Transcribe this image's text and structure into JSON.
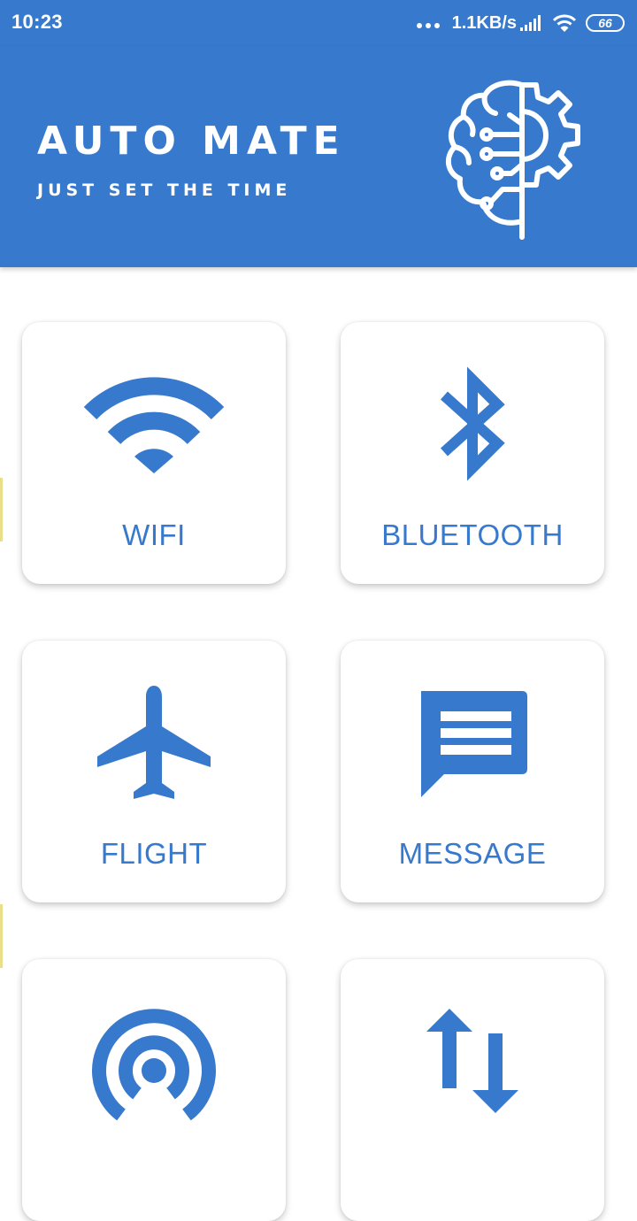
{
  "status_bar": {
    "time": "10:23",
    "network_speed": "1.1KB/s",
    "battery_level": "66"
  },
  "header": {
    "title": "AUTO MATE",
    "subtitle": "JUST SET THE TIME",
    "logo_icon": "brain-gear-icon"
  },
  "colors": {
    "primary": "#3779cc",
    "card_background": "#ffffff",
    "page_background": "#ffffff"
  },
  "cards": [
    {
      "label": "WIFI",
      "icon": "wifi-icon"
    },
    {
      "label": "BLUETOOTH",
      "icon": "bluetooth-icon"
    },
    {
      "label": "FLIGHT",
      "icon": "airplane-icon"
    },
    {
      "label": "MESSAGE",
      "icon": "message-icon"
    },
    {
      "label": "",
      "icon": "hotspot-icon"
    },
    {
      "label": "",
      "icon": "mobile-data-icon"
    }
  ]
}
